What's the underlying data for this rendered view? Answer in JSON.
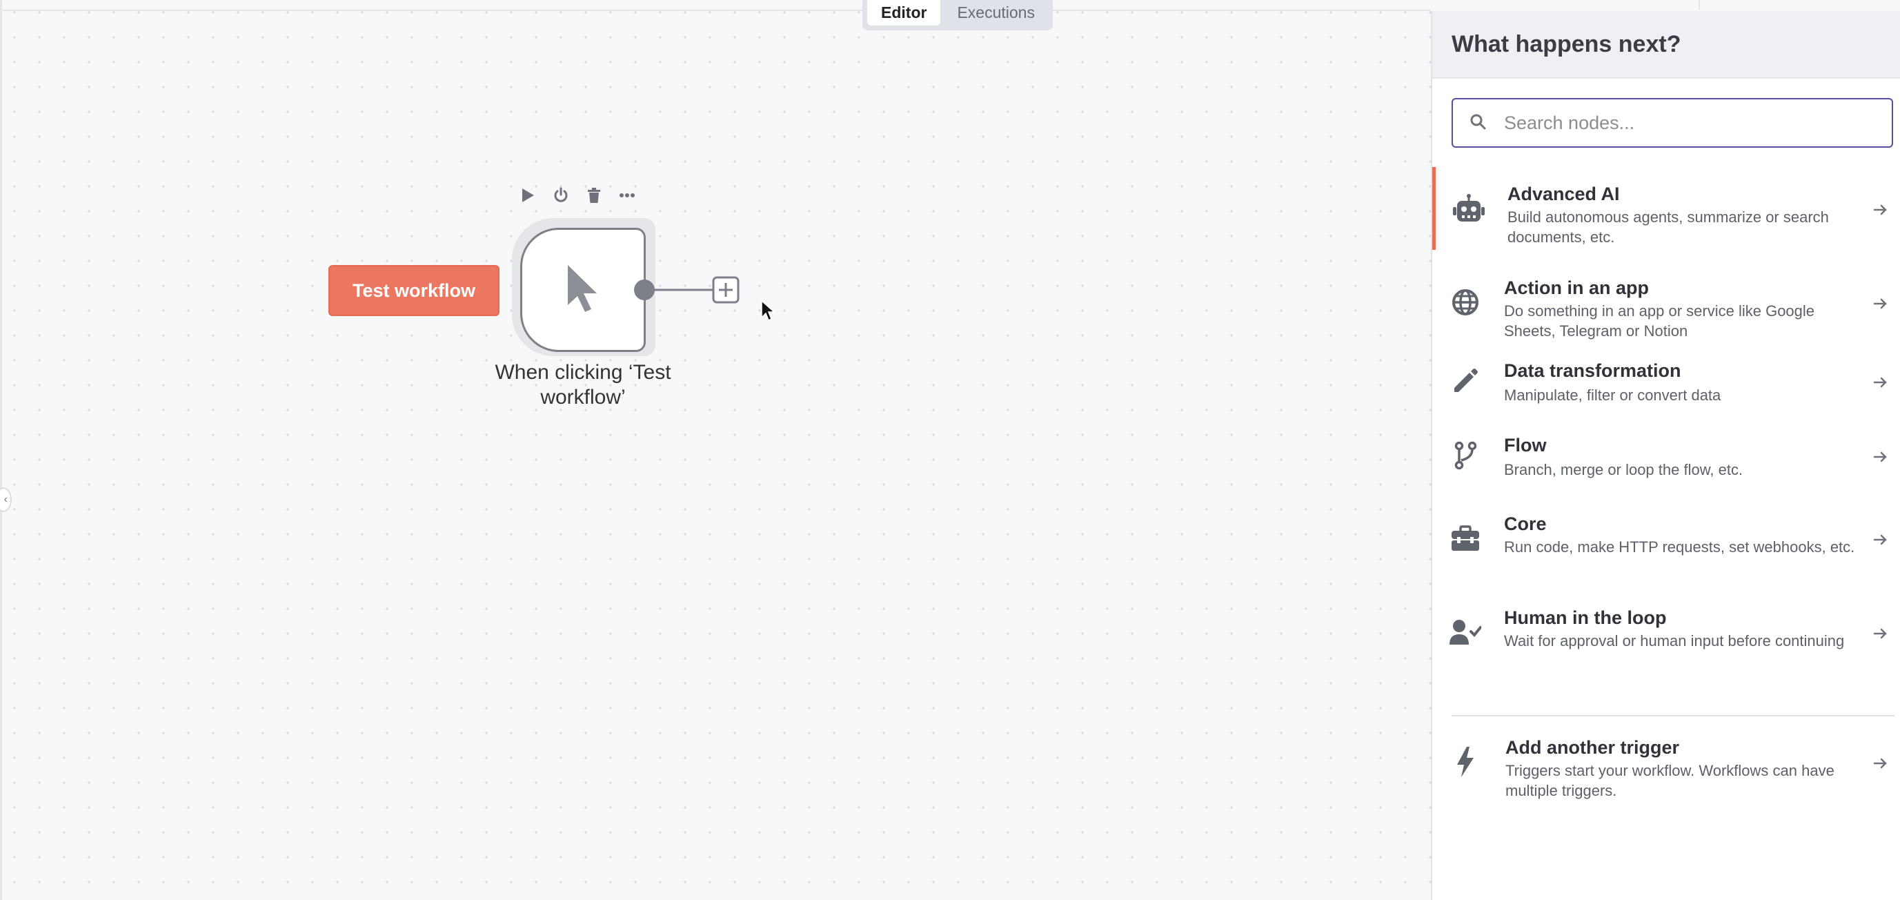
{
  "tabs": [
    {
      "label": "Editor",
      "active": true
    },
    {
      "label": "Executions",
      "active": false
    }
  ],
  "canvas": {
    "test_button": "Test workflow",
    "node_label": "When clicking ‘Test workflow’",
    "node_toolbar": [
      "play-icon",
      "power-icon",
      "trash-icon",
      "more-icon"
    ]
  },
  "panel": {
    "title": "What happens next?",
    "search_placeholder": "Search nodes...",
    "categories": [
      {
        "title": "Advanced AI",
        "desc": "Build autonomous agents, summarize or search documents, etc.",
        "icon": "robot-icon",
        "active": true
      },
      {
        "title": "Action in an app",
        "desc": "Do something in an app or service like Google Sheets, Telegram or Notion",
        "icon": "globe-icon"
      },
      {
        "title": "Data transformation",
        "desc": "Manipulate, filter or convert data",
        "icon": "pencil-icon"
      },
      {
        "title": "Flow",
        "desc": "Branch, merge or loop the flow, etc.",
        "icon": "branch-icon"
      },
      {
        "title": "Core",
        "desc": "Run code, make HTTP requests, set webhooks, etc.",
        "icon": "toolbox-icon"
      },
      {
        "title": "Human in the loop",
        "desc": "Wait for approval or human input before continuing",
        "icon": "user-check-icon"
      }
    ],
    "trigger": {
      "title": "Add another trigger",
      "desc": "Triggers start your workflow. Workflows can have multiple triggers.",
      "icon": "bolt-icon"
    }
  },
  "colors": {
    "accent": "#ec7760",
    "focus": "#5b4d9e"
  }
}
